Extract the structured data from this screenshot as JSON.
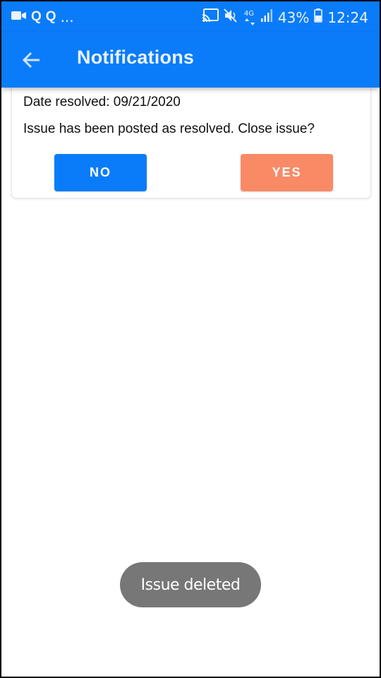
{
  "status_bar": {
    "left_icons": [
      "video-camera-icon",
      "q-app-icon",
      "q-app-icon",
      "more-dots-icon"
    ],
    "left_q1": "Q",
    "left_q2": "Q",
    "left_more": "...",
    "network": "4G",
    "battery": "43%",
    "time": "12:24",
    "right_icons": [
      "cast-icon",
      "mute-icon",
      "network-4g-icon",
      "signal-icon",
      "battery-icon"
    ]
  },
  "app_bar": {
    "title": "Notifications",
    "back_icon": "arrow-left-icon",
    "background": "#0a7cf9"
  },
  "notification": {
    "date_resolved": "Date resolved: 09/21/2020",
    "message": "Issue has been posted as resolved. Close issue?",
    "no_label": "NO",
    "yes_label": "YES",
    "no_color": "#0a7cf9",
    "yes_color": "#f98a66"
  },
  "toast": {
    "message": "Issue deleted"
  }
}
